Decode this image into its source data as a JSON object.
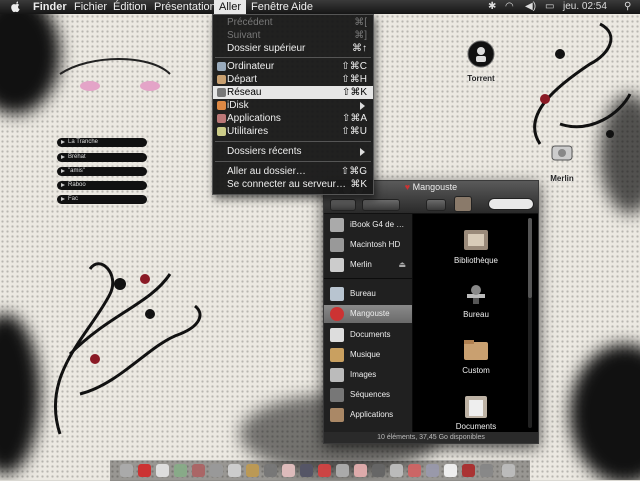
{
  "menubar": {
    "app_name": "Finder",
    "items": [
      "Fichier",
      "Édition",
      "Présentation",
      "Aller",
      "Fenêtre",
      "Aide"
    ],
    "active_item": "Aller",
    "clock": "jeu. 02:54"
  },
  "go_menu": {
    "items": [
      {
        "label": "Précédent",
        "shortcut": "⌘[",
        "disabled": true
      },
      {
        "label": "Suivant",
        "shortcut": "⌘]",
        "disabled": true
      },
      {
        "label": "Dossier supérieur",
        "shortcut": "⌘↑",
        "disabled": false
      },
      {
        "label": "Ordinateur",
        "shortcut": "⇧⌘C",
        "icon": "computer-icon"
      },
      {
        "label": "Départ",
        "shortcut": "⇧⌘H",
        "icon": "home-icon"
      },
      {
        "label": "Réseau",
        "shortcut": "⇧⌘K",
        "icon": "network-icon",
        "highlighted": true
      },
      {
        "label": "iDisk",
        "submenu": true,
        "icon": "idisk-icon"
      },
      {
        "label": "Applications",
        "shortcut": "⇧⌘A",
        "icon": "applications-icon"
      },
      {
        "label": "Utilitaires",
        "shortcut": "⇧⌘U",
        "icon": "utilities-icon"
      },
      {
        "label": "Dossiers récents",
        "submenu": true
      },
      {
        "label": "Aller au dossier…",
        "shortcut": "⇧⌘G"
      },
      {
        "label": "Se connecter au serveur…",
        "shortcut": "⌘K"
      }
    ]
  },
  "desktop": {
    "list_items": [
      "La Tranche",
      "Bréhat",
      "\"amis\"",
      "Raboo",
      "Fac"
    ],
    "icons": [
      {
        "label": "Torrent",
        "icon": "torrent-icon"
      },
      {
        "label": "Merlin",
        "icon": "network-volume-icon"
      }
    ]
  },
  "finder_window": {
    "title": "Mangouste",
    "sidebar": {
      "devices": [
        {
          "label": "iBook G4 de …",
          "icon": "laptop-icon"
        },
        {
          "label": "Macintosh HD",
          "icon": "hard-disk-icon"
        },
        {
          "label": "Merlin",
          "icon": "network-volume-icon",
          "eject": true
        }
      ],
      "places": [
        {
          "label": "Bureau",
          "icon": "desktop-folder-icon"
        },
        {
          "label": "Mangouste",
          "icon": "home-icon",
          "selected": true
        },
        {
          "label": "Documents",
          "icon": "documents-folder-icon"
        },
        {
          "label": "Musique",
          "icon": "music-folder-icon"
        },
        {
          "label": "Images",
          "icon": "pictures-folder-icon"
        },
        {
          "label": "Séquences",
          "icon": "movies-folder-icon"
        },
        {
          "label": "Applications",
          "icon": "applications-folder-icon"
        }
      ]
    },
    "content_items": [
      {
        "label": "Bibliothèque",
        "icon": "library-folder-icon"
      },
      {
        "label": "Bureau",
        "icon": "desktop-folder-icon"
      },
      {
        "label": "Custom",
        "icon": "folder-icon"
      },
      {
        "label": "Documents",
        "icon": "documents-folder-icon"
      }
    ],
    "status": "10 éléments, 37,45 Go disponibles"
  }
}
